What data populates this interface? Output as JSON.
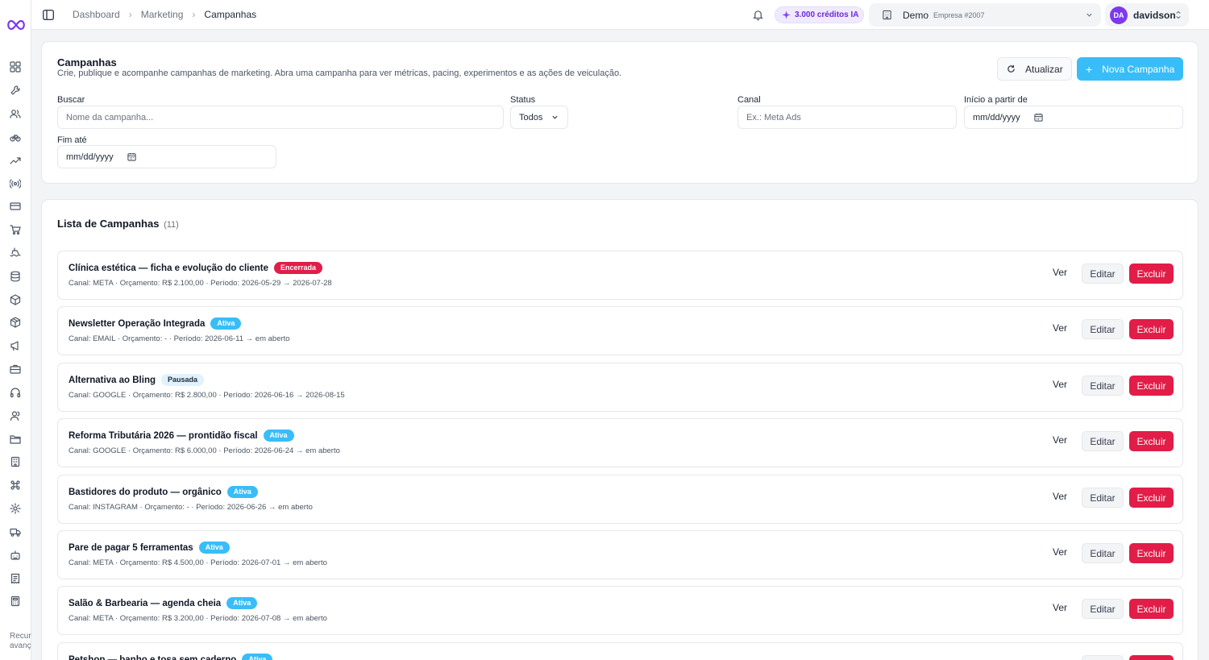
{
  "topbar": {
    "breadcrumb": [
      "Dashboard",
      "Marketing",
      "Campanhas"
    ],
    "credits": "3.000 créditos IA",
    "company_name": "Demo",
    "company_sub": "Empresa #2007",
    "user_initials": "DA",
    "user_name": "davidson"
  },
  "sidebar": {
    "icons": [
      "grid-icon",
      "wrench-icon",
      "users-icon",
      "bike-icon",
      "trending-up-icon",
      "radio-icon",
      "credit-card-icon",
      "shopping-cart-icon",
      "ship-icon",
      "database-icon",
      "box-icon",
      "package-icon",
      "megaphone-icon",
      "briefcase-icon",
      "headphones-icon",
      "user-group-icon",
      "folder-icon",
      "building-icon",
      "command-icon",
      "settings-icon",
      "truck-icon",
      "bot-icon",
      "receipt-icon",
      "calculator-icon"
    ],
    "footer_text": "Recursos avançados"
  },
  "filters": {
    "title": "Campanhas",
    "description": "Crie, publique e acompanhe campanhas de marketing. Abra uma campanha para ver métricas, pacing, experimentos e as ações de veiculação.",
    "refresh_label": "Atualizar",
    "new_label": "Nova Campanha",
    "search_label": "Buscar",
    "search_placeholder": "Nome da campanha...",
    "status_label": "Status",
    "status_value": "Todos",
    "channel_label": "Canal",
    "channel_placeholder": "Ex.: Meta Ads",
    "start_label": "Início a partir de",
    "start_value": "mm/dd/yyyy",
    "end_label": "Fim até",
    "end_value": "mm/dd/yyyy"
  },
  "list": {
    "title": "Lista de Campanhas",
    "count": "(11)",
    "action_view": "Ver",
    "action_edit": "Editar",
    "action_delete": "Excluir",
    "rows": [
      {
        "name": "Clínica estética — ficha e evolução do cliente",
        "status": "Encerrada",
        "meta": "Canal: META · Orçamento: R$ 2.100,00 · Período: 2026-05-29 → 2026-07-28"
      },
      {
        "name": "Newsletter Operação Integrada",
        "status": "Ativa",
        "meta": "Canal: EMAIL · Orçamento: - · Período: 2026-06-11 → em aberto"
      },
      {
        "name": "Alternativa ao Bling",
        "status": "Pausada",
        "meta": "Canal: GOOGLE · Orçamento: R$ 2.800,00 · Período: 2026-06-16 → 2026-08-15"
      },
      {
        "name": "Reforma Tributária 2026 — prontidão fiscal",
        "status": "Ativa",
        "meta": "Canal: GOOGLE · Orçamento: R$ 6.000,00 · Período: 2026-06-24 → em aberto"
      },
      {
        "name": "Bastidores do produto — orgânico",
        "status": "Ativa",
        "meta": "Canal: INSTAGRAM · Orçamento: - · Período: 2026-06-26 → em aberto"
      },
      {
        "name": "Pare de pagar 5 ferramentas",
        "status": "Ativa",
        "meta": "Canal: META · Orçamento: R$ 4.500,00 · Período: 2026-07-01 → em aberto"
      },
      {
        "name": "Salão & Barbearia — agenda cheia",
        "status": "Ativa",
        "meta": "Canal: META · Orçamento: R$ 3.200,00 · Período: 2026-07-08 → em aberto"
      },
      {
        "name": "Petshop — banho e tosa sem caderno",
        "status": "Ativa",
        "meta": ""
      }
    ]
  }
}
